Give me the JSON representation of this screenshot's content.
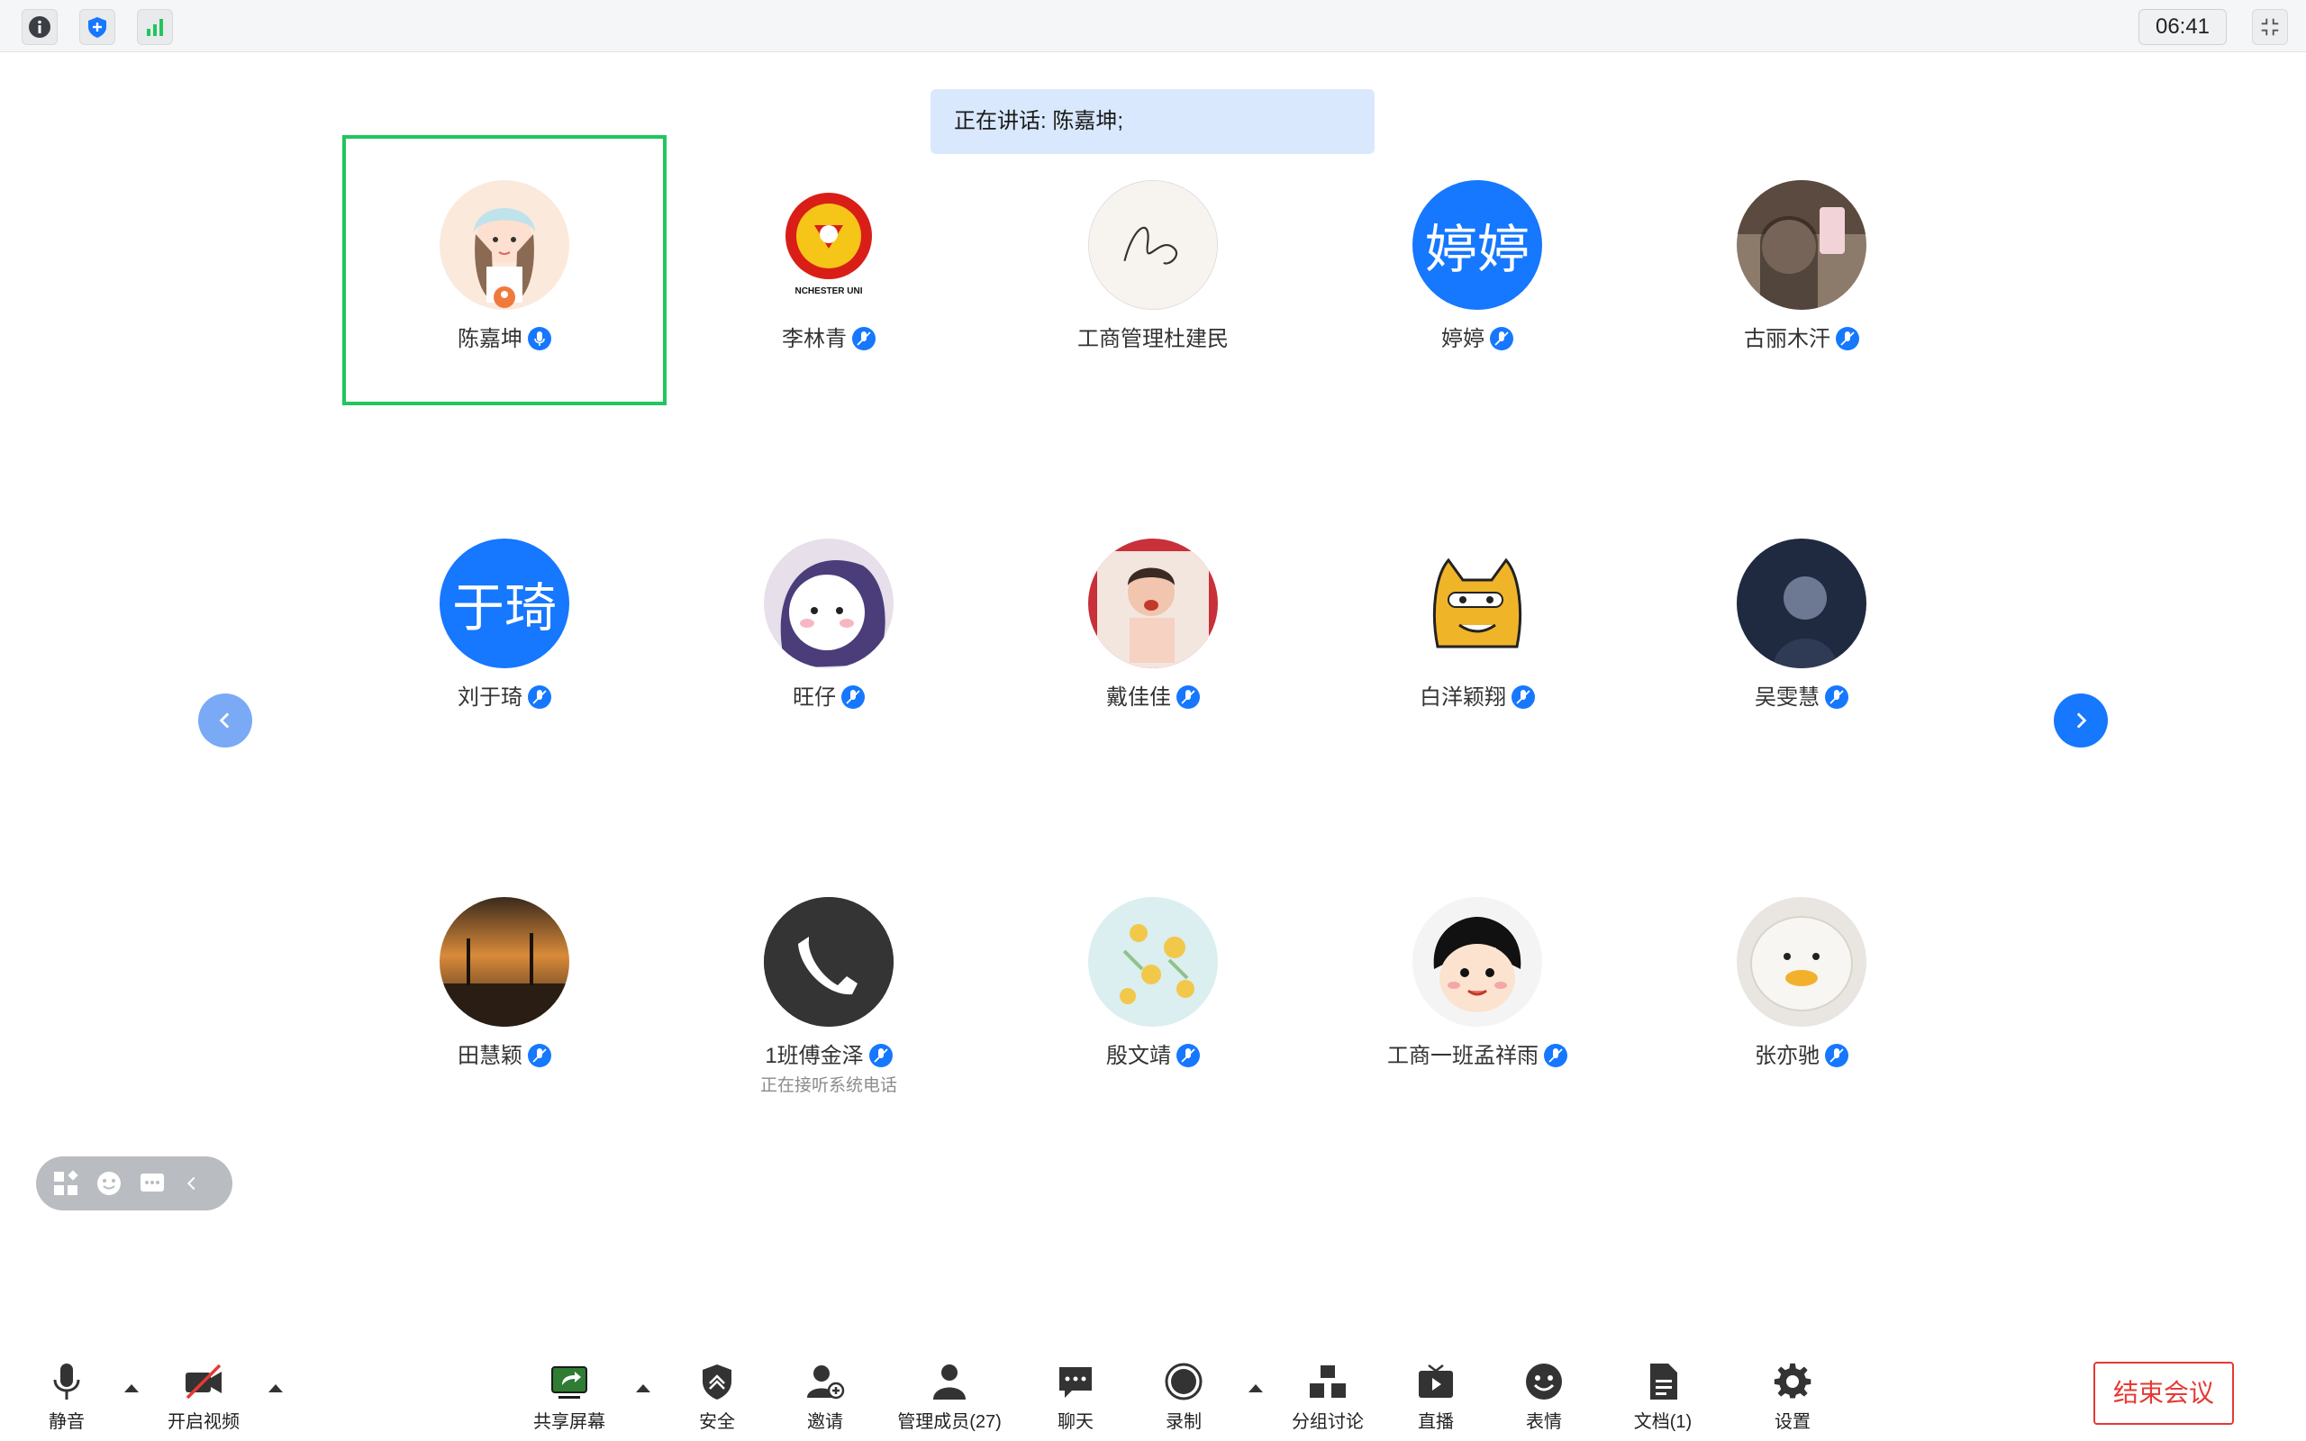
{
  "topbar": {
    "icons": [
      "info-icon",
      "shield-icon",
      "signal-icon"
    ],
    "clock": "06:41"
  },
  "speaking_banner": "正在讲话: 陈嘉坤;",
  "participants": [
    {
      "name": "陈嘉坤",
      "avatar": "cartoon-girl"
    },
    {
      "name": "李林青",
      "avatar": "manchester-logo",
      "avatar_caption": "NCHESTER UNI"
    },
    {
      "name": "工商管理杜建民",
      "avatar": "signature"
    },
    {
      "name": "婷婷",
      "avatar_text": "婷婷"
    },
    {
      "name": "古丽木汗",
      "avatar": "photo-woman"
    },
    {
      "name": "刘于琦",
      "avatar_text": "于琦"
    },
    {
      "name": "旺仔",
      "avatar": "cartoon-blue-hood"
    },
    {
      "name": "戴佳佳",
      "avatar": "photo-child"
    },
    {
      "name": "白洋颖翔",
      "avatar": "shiba-dog"
    },
    {
      "name": "吴雯慧",
      "avatar": "photo-dark"
    },
    {
      "name": "田慧颖",
      "avatar": "sunset"
    },
    {
      "name": "1班傅金泽",
      "avatar": "phone",
      "status": "正在接听系统电话"
    },
    {
      "name": "殷文靖",
      "avatar": "flowers"
    },
    {
      "name": "工商一班孟祥雨",
      "avatar": "cartoon-girl-maruko"
    },
    {
      "name": "张亦驰",
      "avatar": "fluffy-duck"
    }
  ],
  "toolbar": {
    "mute": "静音",
    "video": "开启视频",
    "share": "共享屏幕",
    "security": "安全",
    "invite": "邀请",
    "members": "管理成员(27)",
    "chat": "聊天",
    "record": "录制",
    "breakout": "分组讨论",
    "live": "直播",
    "reactions": "表情",
    "docs": "文档(1)",
    "settings": "设置",
    "end": "结束会议"
  },
  "colors": {
    "accent": "#1677ff",
    "active_speaker": "#22c55e",
    "end_red": "#e53935",
    "banner_bg": "#d9e8fd"
  }
}
